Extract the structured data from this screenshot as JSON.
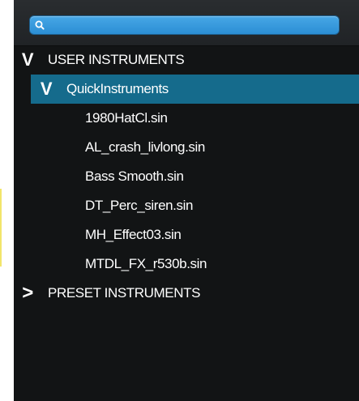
{
  "search": {
    "value": "",
    "placeholder": ""
  },
  "tree": {
    "user_instruments": {
      "label": "USER INSTRUMENTS",
      "expanded": true,
      "chevron": "V"
    },
    "quick_instruments": {
      "label": "QuickInstruments",
      "expanded": true,
      "selected": true,
      "chevron": "V",
      "items": [
        {
          "label": "1980HatCl.sin"
        },
        {
          "label": "AL_crash_livlong.sin"
        },
        {
          "label": "Bass Smooth.sin"
        },
        {
          "label": "DT_Perc_siren.sin"
        },
        {
          "label": "MH_Effect03.sin"
        },
        {
          "label": "MTDL_FX_r530b.sin"
        }
      ]
    },
    "preset_instruments": {
      "label": "PRESET INSTRUMENTS",
      "expanded": false,
      "chevron": ">"
    }
  },
  "colors": {
    "panel_background": "#121415",
    "selected_row": "#156b8c",
    "search_field": "#2b8ed4",
    "text": "#ffffff"
  },
  "icons": {
    "search": "search-icon",
    "expanded": "chevron-down-icon",
    "collapsed": "chevron-right-icon"
  }
}
